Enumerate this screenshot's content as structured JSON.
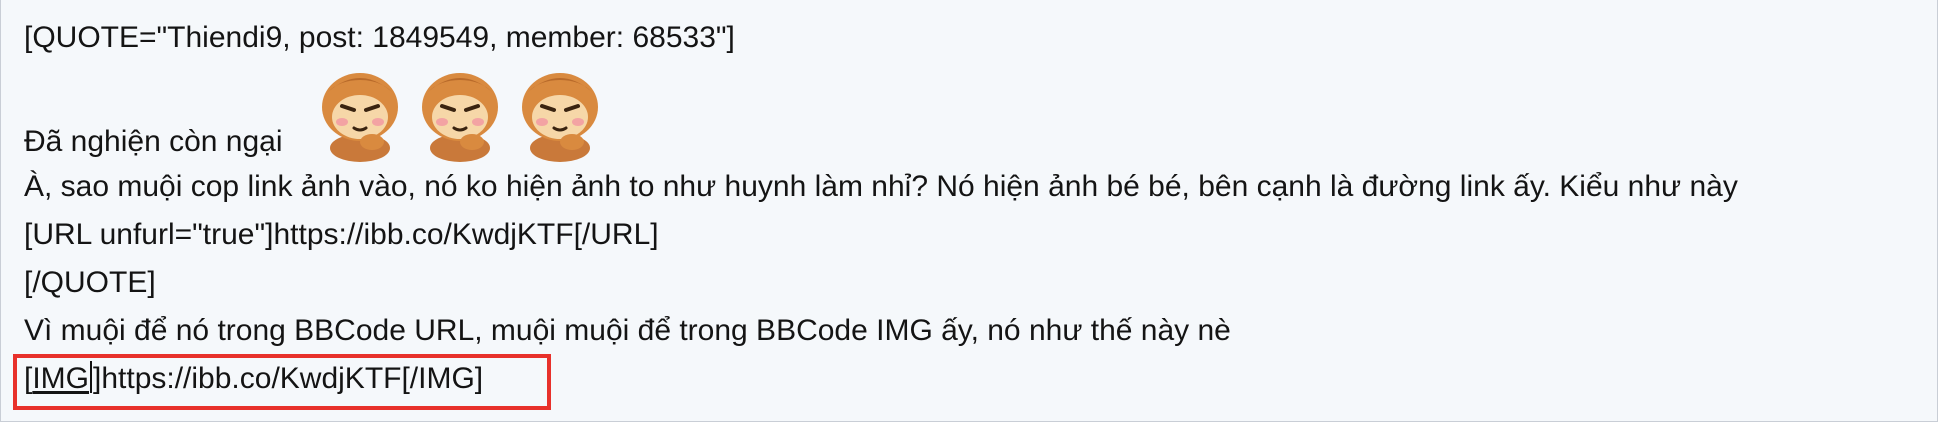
{
  "editor": {
    "quote_open": "[QUOTE=\"Thiendi9, post: 1849549, member: 68533\"]",
    "line_shy_text": "Đã nghiện còn ngại",
    "emojis": [
      "monkey-thinking-icon",
      "monkey-thinking-icon",
      "monkey-thinking-icon"
    ],
    "question": "À, sao muội cop link ảnh vào, nó ko hiện ảnh to như huynh làm nhỉ? Nó hiện ảnh bé bé, bên cạnh là đường link ấy. Kiểu như này",
    "url_line": "[URL unfurl=\"true\"]https://ibb.co/KwdjKTF[/URL]",
    "quote_close": "[/QUOTE]",
    "answer": "Vì muội để nó trong BBCode URL, muội muội để trong BBCode IMG ấy, nó như thế này nè",
    "img_line": {
      "open_bracket": "[",
      "tag": "IMG",
      "rest": "]https://ibb.co/KwdjKTF[/IMG]"
    }
  },
  "colors": {
    "editor_bg": "#f5f8fb",
    "highlight": "#e8312b",
    "text": "#141414"
  }
}
